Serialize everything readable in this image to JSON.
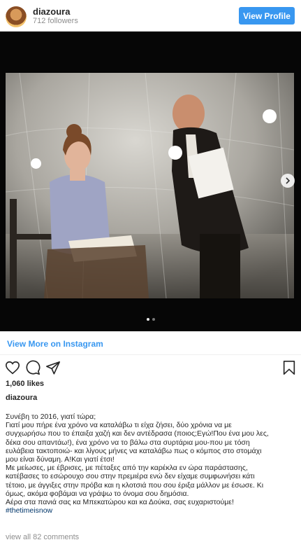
{
  "header": {
    "username": "diazoura",
    "followers": "712 followers",
    "view_profile_label": "View Profile"
  },
  "media": {
    "carousel_count": 2,
    "active_index": 0,
    "icons": [
      "chevron-right-icon"
    ]
  },
  "post": {
    "view_more_label": "View More on Instagram",
    "likes": "1,060 likes",
    "caption_username": "diazoura",
    "caption_lines": [
      "Συνέβη το 2016, γιατί τώρα;",
      "Γιατί μου πήρε ένα χρόνο να καταλάβω τι είχα ζήσει, δύο χρόνια να με",
      "συγχωρήσω που το έπαιξα χαζή και δεν αντέδρασα (ποιος;Εγώ!Που ένα μου λες,",
      "δέκα σου απαντάω!), ένα χρόνο να το βάλω στα συρτάρια μου-που με τόση",
      "ευλάβεια τακτοποιώ- και λίγους μήνες να καταλάβω πως ο κόμπος στο στομάχι",
      "μου είναι δύναμη. Α!Και γιατί έτσι!",
      "Με μείωσες, με έβρισες, με πέταξες από την καρέκλα εν ώρα παράστασης,",
      "κατέβασες το εσώρουχο σου στην πρεμιέρα ενώ δεν είχαμε συμφωνήσει κάτι",
      "τέτοιο, με άγγιξες στην πρόβα και η κλοτσιά που σου έριξα μάλλον με έσωσε. Κι",
      "όμως, ακόμα φοβάμαι να γράψω το όνομα σου δημόσια.",
      "Αέρα στα πανιά σας κα Μπεκατώρου και κα Δούκα, σας ευχαριστούμε!"
    ],
    "hashtag": "#thetimeisnow",
    "comments_label": "view all 82 comments"
  },
  "icons": [
    "avatar",
    "heart-icon",
    "comment-icon",
    "share-icon",
    "bookmark-icon"
  ],
  "colors": {
    "accent": "#3897f0",
    "text": "#262626",
    "muted": "#8e8e8e",
    "hashtag": "#003569"
  }
}
